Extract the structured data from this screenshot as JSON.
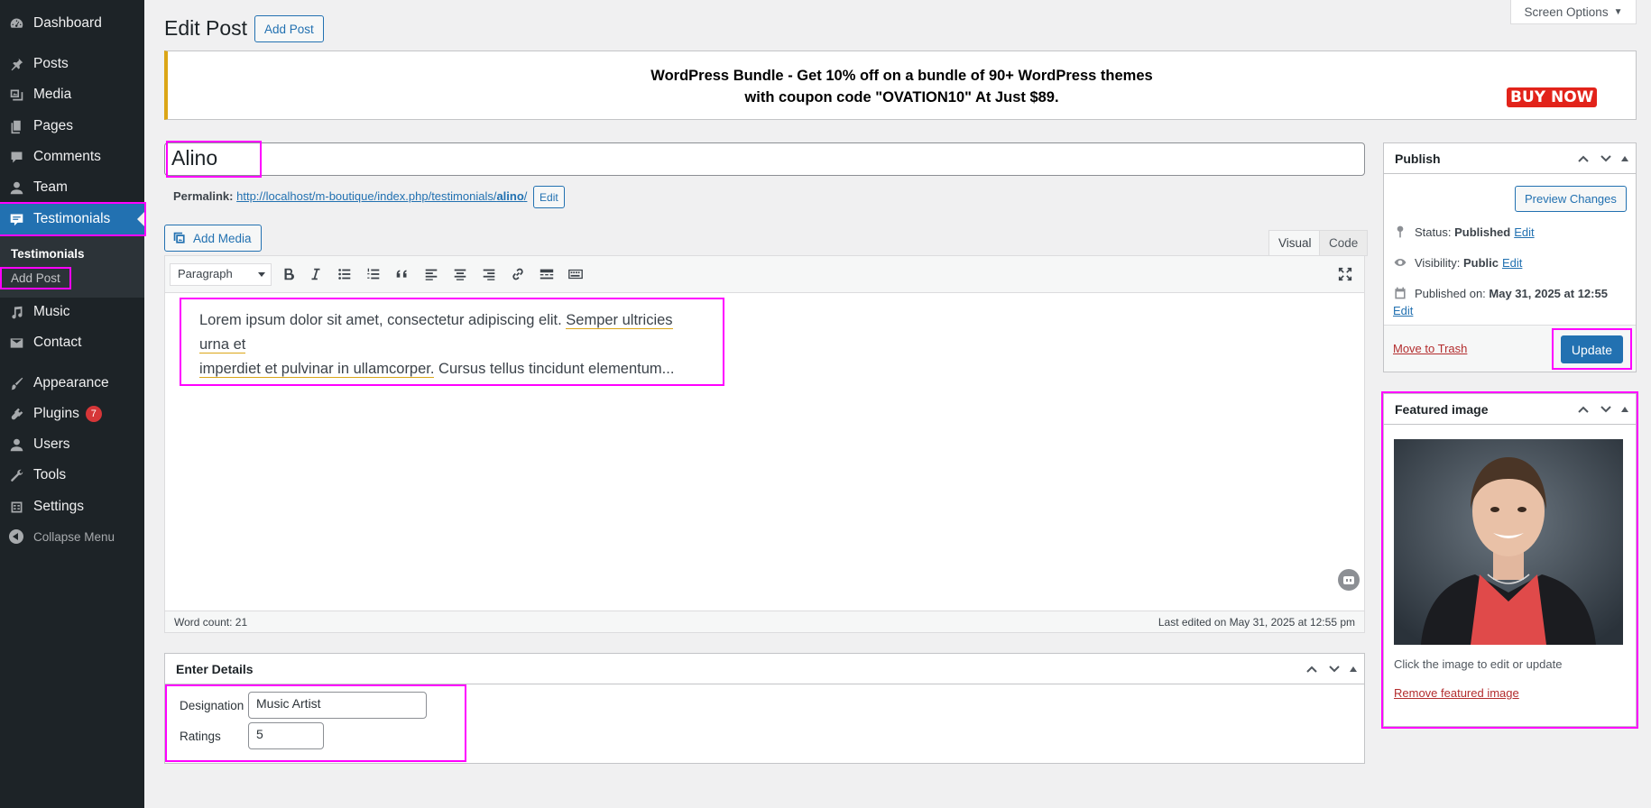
{
  "sidebar": {
    "items": [
      {
        "label": "Dashboard",
        "icon": "dashboard-icon"
      },
      {
        "label": "Posts",
        "icon": "pin-icon"
      },
      {
        "label": "Media",
        "icon": "media-icon"
      },
      {
        "label": "Pages",
        "icon": "pages-icon"
      },
      {
        "label": "Comments",
        "icon": "comment-icon"
      },
      {
        "label": "Team",
        "icon": "user-icon"
      },
      {
        "label": "Testimonials",
        "icon": "testimonial-icon"
      },
      {
        "label": "Music",
        "icon": "music-icon"
      },
      {
        "label": "Contact",
        "icon": "mail-icon"
      },
      {
        "label": "Appearance",
        "icon": "brush-icon"
      },
      {
        "label": "Plugins",
        "icon": "plugin-icon",
        "badge": "7"
      },
      {
        "label": "Users",
        "icon": "users-icon"
      },
      {
        "label": "Tools",
        "icon": "wrench-icon"
      },
      {
        "label": "Settings",
        "icon": "settings-icon"
      }
    ],
    "submenu": [
      "Testimonials",
      "Add Post"
    ],
    "collapse_label": "Collapse Menu"
  },
  "header": {
    "screen_options": "Screen Options",
    "title": "Edit Post",
    "add_post": "Add Post"
  },
  "promo": {
    "line1": "WordPress Bundle - Get 10% off on a bundle of 90+ WordPress themes",
    "line2": "with coupon code \"OVATION10\" At Just $89.",
    "cta": "BUY NOW"
  },
  "post": {
    "title": "Alino",
    "permalink_label": "Permalink:",
    "permalink_base": "http://localhost/m-boutique/index.php/testimonials/",
    "permalink_slug": "alino",
    "permalink_end": "/",
    "permalink_edit": "Edit"
  },
  "editor": {
    "add_media": "Add Media",
    "tab_visual": "Visual",
    "tab_code": "Code",
    "format": "Paragraph",
    "content_plain1": "Lorem ipsum dolor sit amet, consectetur adipiscing elit. ",
    "content_mark1": "Semper ultricies urna et",
    "content_mark2": "imperdiet et pulvinar in ullamcorper.",
    "content_plain2": " Cursus tellus tincidunt elementum...",
    "word_count": "Word count: 21",
    "last_edited": "Last edited on May 31, 2025 at 12:55 pm"
  },
  "details": {
    "title": "Enter Details",
    "designation_label": "Designation",
    "designation_value": "Music Artist",
    "ratings_label": "Ratings",
    "ratings_value": "5"
  },
  "publish": {
    "title": "Publish",
    "preview": "Preview Changes",
    "status_label": "Status:",
    "status_value": "Published",
    "visibility_label": "Visibility:",
    "visibility_value": "Public",
    "published_label": "Published on:",
    "published_value": "May 31, 2025 at 12:55",
    "edit": "Edit",
    "trash": "Move to Trash",
    "update": "Update"
  },
  "featured": {
    "title": "Featured image",
    "caption": "Click the image to edit or update",
    "remove": "Remove featured image"
  },
  "colors": {
    "accent": "#2271b1",
    "sidebar_bg": "#1d2327",
    "highlight": "#ff00ff",
    "promo_border": "#dba617",
    "buy_now": "#e2231a"
  }
}
